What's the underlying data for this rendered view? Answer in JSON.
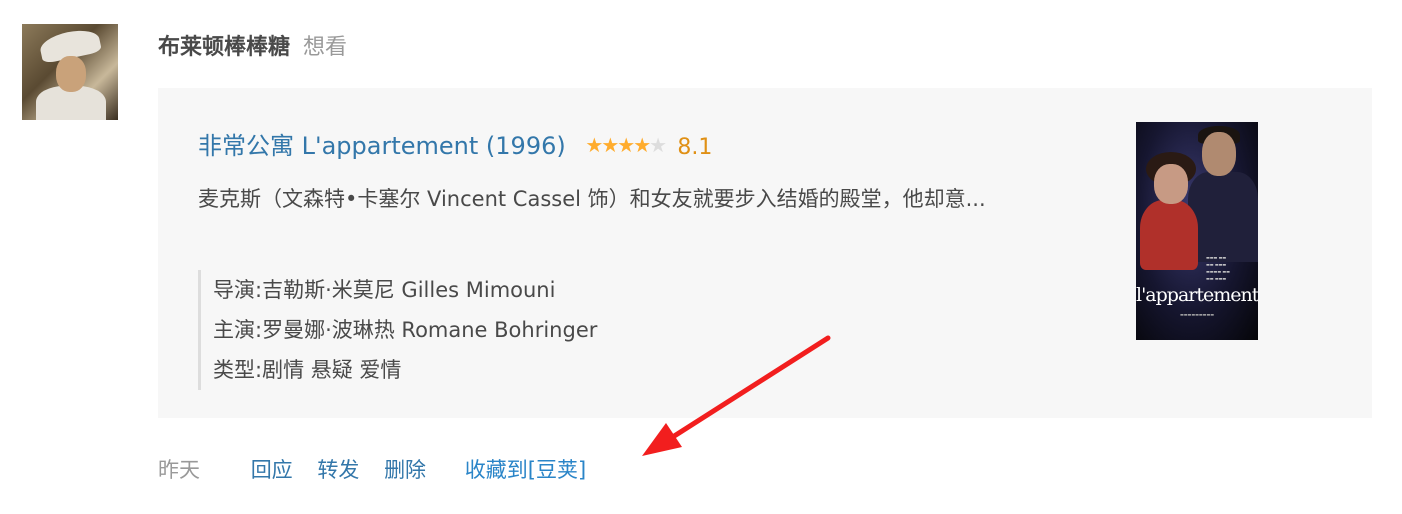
{
  "user": {
    "name": "布莱顿棒棒糖",
    "action": "想看"
  },
  "movie": {
    "title": "非常公寓 L'appartement (1996)",
    "stars_filled": 4,
    "stars_total": 5,
    "rating": "8.1",
    "description": "麦克斯（文森特•卡塞尔 Vincent Cassel 饰）和女友就要步入结婚的殿堂，他却意...",
    "director": "导演:吉勒斯·米莫尼 Gilles Mimouni",
    "cast": "主演:罗曼娜·波琳热 Romane Bohringer",
    "genre": "类型:剧情 悬疑 爱情",
    "poster_title": "l'appartement"
  },
  "footer": {
    "time": "昨天",
    "reply": "回应",
    "forward": "转发",
    "delete": "删除",
    "collect": "收藏到[豆荚]"
  },
  "colors": {
    "link": "#3377aa",
    "rating": "#e09015",
    "star": "#ffac2d",
    "card_bg": "#f7f7f7",
    "arrow": "#f21e1e"
  }
}
